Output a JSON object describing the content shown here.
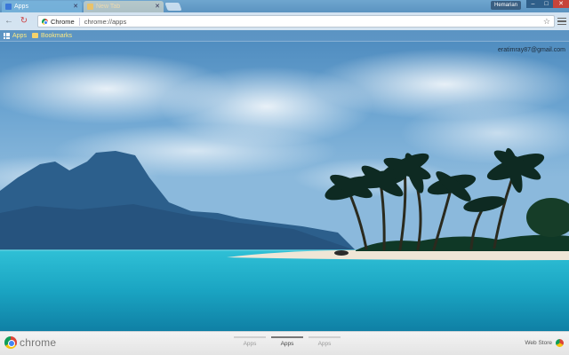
{
  "tabs": [
    {
      "title": "Apps",
      "active": true
    },
    {
      "title": "New Tab",
      "active": false
    }
  ],
  "window": {
    "user": "Hemarian",
    "minimize": "–",
    "maximize": "□",
    "close": "✕"
  },
  "toolbar": {
    "back_icon": "←",
    "forward_icon": "→",
    "reload_icon": "↻",
    "chip_label": "Chrome",
    "url": "chrome://apps",
    "star_icon": "☆"
  },
  "bookmarks": {
    "apps_label": "Apps",
    "folder_label": "Bookmarks"
  },
  "account": {
    "email": "eratimray87@gmail.com"
  },
  "bottom_bar": {
    "brand": "chrome",
    "pages": [
      {
        "label": "Apps",
        "active": false
      },
      {
        "label": "Apps",
        "active": true
      },
      {
        "label": "Apps",
        "active": false
      }
    ],
    "web_store_label": "Web Store"
  },
  "colors": {
    "sky": "#4a8ec2",
    "sea": "#1fa6c4",
    "close_button": "#c7443b"
  }
}
